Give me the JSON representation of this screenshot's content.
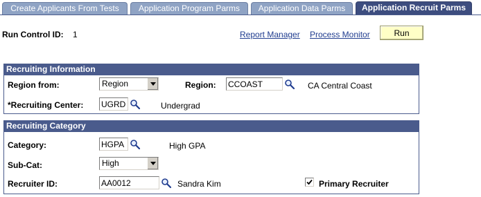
{
  "tabs": [
    {
      "label": "Create Applicants From Tests",
      "active": false
    },
    {
      "label": "Application Program Parms",
      "active": false
    },
    {
      "label": "Application Data Parms",
      "active": false
    },
    {
      "label": "Application Recruit Parms",
      "active": true
    }
  ],
  "run_control": {
    "label": "Run Control ID:",
    "value": "1"
  },
  "links": {
    "report_manager": "Report Manager",
    "process_monitor": "Process Monitor"
  },
  "run_button": "Run",
  "recruiting_info": {
    "header": "Recruiting Information",
    "region_from": {
      "label": "Region from:",
      "value": "Region"
    },
    "region": {
      "label": "Region:",
      "value": "CCOAST",
      "description": "CA Central Coast"
    },
    "recruiting_center": {
      "label": "*Recruiting Center:",
      "value": "UGRD",
      "description": "Undergrad"
    }
  },
  "recruiting_category": {
    "header": "Recruiting Category",
    "category": {
      "label": "Category:",
      "value": "HGPA",
      "description": "High GPA"
    },
    "sub_cat": {
      "label": "Sub-Cat:",
      "value": "High"
    },
    "recruiter_id": {
      "label": "Recruiter ID:",
      "value": "AA0012",
      "description": "Sandra Kim"
    },
    "primary_recruiter": {
      "label": "Primary Recruiter",
      "checked": true
    }
  },
  "colors": {
    "tab_inactive": "#8fa3c4",
    "tab_active": "#3d4d7f",
    "group_header": "#4a5b8c",
    "run_button": "#ffffc6",
    "link": "#1f3c8f"
  }
}
